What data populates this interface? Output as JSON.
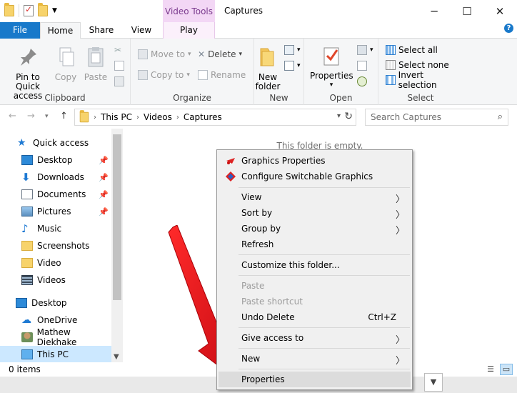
{
  "window": {
    "title": "Captures",
    "contextual_tab_group": "Video Tools"
  },
  "ribbon_tabs": {
    "file": "File",
    "home": "Home",
    "share": "Share",
    "view": "View",
    "play": "Play"
  },
  "ribbon": {
    "clipboard": {
      "label": "Clipboard",
      "pin": "Pin to Quick access",
      "copy": "Copy",
      "paste": "Paste"
    },
    "organize": {
      "label": "Organize",
      "move_to": "Move to",
      "copy_to": "Copy to",
      "delete": "Delete",
      "rename": "Rename"
    },
    "new": {
      "label": "New",
      "new_folder": "New folder"
    },
    "open": {
      "label": "Open",
      "properties": "Properties"
    },
    "select": {
      "label": "Select",
      "select_all": "Select all",
      "select_none": "Select none",
      "invert": "Invert selection"
    }
  },
  "address": {
    "crumbs": [
      "This PC",
      "Videos",
      "Captures"
    ],
    "search_placeholder": "Search Captures"
  },
  "nav": {
    "items": [
      {
        "label": "Quick access",
        "icon": "star-icon",
        "pinned": false
      },
      {
        "label": "Desktop",
        "icon": "desktop-icon",
        "pinned": true
      },
      {
        "label": "Downloads",
        "icon": "download-icon",
        "pinned": true
      },
      {
        "label": "Documents",
        "icon": "documents-icon",
        "pinned": true
      },
      {
        "label": "Pictures",
        "icon": "pictures-icon",
        "pinned": true
      },
      {
        "label": "Music",
        "icon": "music-icon",
        "pinned": false
      },
      {
        "label": "Screenshots",
        "icon": "folder-icon",
        "pinned": false
      },
      {
        "label": "Video",
        "icon": "folder-icon",
        "pinned": false
      },
      {
        "label": "Videos",
        "icon": "videos-icon",
        "pinned": false
      },
      {
        "label": "Desktop",
        "icon": "desktop-icon",
        "pinned": false
      },
      {
        "label": "OneDrive",
        "icon": "onedrive-icon",
        "pinned": false
      },
      {
        "label": "Mathew Diekhake",
        "icon": "user-icon",
        "pinned": false
      },
      {
        "label": "This PC",
        "icon": "this-pc-icon",
        "pinned": false
      }
    ]
  },
  "content": {
    "empty_message": "This folder is empty."
  },
  "status": {
    "item_count": "0 items"
  },
  "context_menu": {
    "items": [
      {
        "label": "Graphics Properties",
        "icon": "graphics-properties-icon"
      },
      {
        "label": "Configure Switchable Graphics",
        "icon": "switchable-graphics-icon"
      },
      {
        "label": "View",
        "submenu": true
      },
      {
        "label": "Sort by",
        "submenu": true
      },
      {
        "label": "Group by",
        "submenu": true
      },
      {
        "label": "Refresh"
      },
      {
        "label": "Customize this folder..."
      },
      {
        "label": "Paste",
        "disabled": true
      },
      {
        "label": "Paste shortcut",
        "disabled": true
      },
      {
        "label": "Undo Delete",
        "shortcut": "Ctrl+Z"
      },
      {
        "label": "Give access to",
        "submenu": true
      },
      {
        "label": "New",
        "submenu": true
      },
      {
        "label": "Properties",
        "highlighted": true
      }
    ]
  },
  "colors": {
    "file_tab": "#1979ca",
    "contextual_tab": "#f3d7f5",
    "selection": "#cce8ff",
    "arrow": "#e8141c"
  }
}
